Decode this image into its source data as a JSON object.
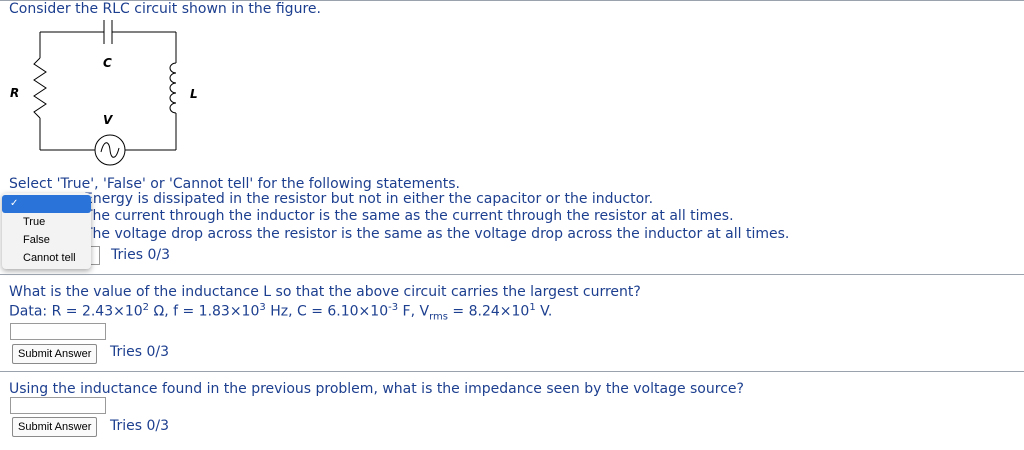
{
  "intro": "Consider the RLC circuit shown in the figure.",
  "circuit": {
    "label_c": "C",
    "label_r": "R",
    "label_l": "L",
    "label_v": "V"
  },
  "select_prompt": "Select 'True', 'False' or 'Cannot tell' for the following statements.",
  "statements": [
    "Energy is dissipated in the resistor but not in either the capacitor or the inductor.",
    "The current through the inductor is the same as the current through the resistor at all times.",
    "The voltage drop across the resistor is the same as the voltage drop across the inductor at all times."
  ],
  "dropdown": {
    "selected_mark": "✓",
    "options": [
      "True",
      "False",
      "Cannot tell"
    ]
  },
  "tries1": "Tries 0/3",
  "q2": {
    "question": "What is the value of the inductance L so that the above circuit carries the largest current?",
    "data_prefix": "Data: R = 2.43×10",
    "r_exp": "2",
    "r_unit": " Ω, f = 1.83×10",
    "f_exp": "3",
    "f_unit": " Hz, C = 6.10×10",
    "c_exp": "-3",
    "c_unit": " F, V",
    "v_sub": "rms",
    "v_val": " = 8.24×10",
    "v_exp": "1",
    "v_unit": " V.",
    "submit": "Submit Answer",
    "tries": "Tries 0/3"
  },
  "q3": {
    "question": "Using the inductance found in the previous problem, what is the impedance seen by the voltage source?",
    "submit": "Submit Answer",
    "tries": "Tries 0/3"
  }
}
